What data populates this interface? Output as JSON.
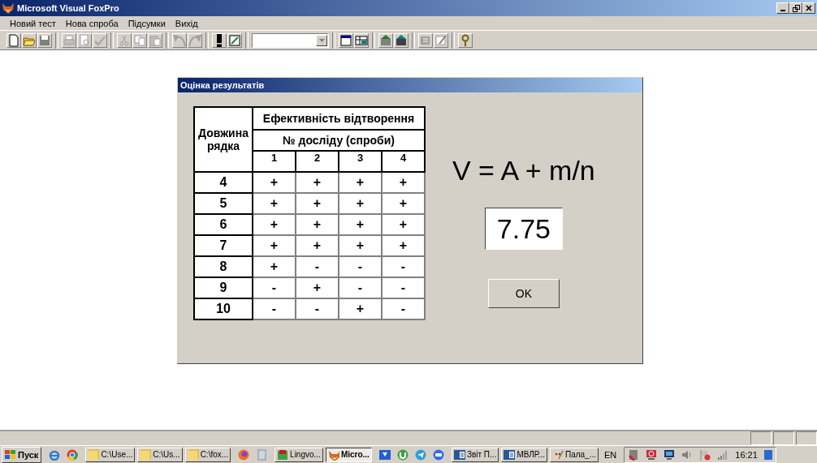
{
  "window": {
    "title": "Microsoft Visual FoxPro"
  },
  "menu": [
    "Новий тест",
    "Нова спроба",
    "Підсумки",
    "Вихід"
  ],
  "toolbar": {
    "combo_value_empty": true
  },
  "dialog": {
    "title": "Оцінка результатів",
    "table": {
      "row_header": "Довжина рядка",
      "group_header": "Ефективність відтворення",
      "subgroup_header": "№ досліду (спроби)",
      "columns": [
        "1",
        "2",
        "3",
        "4"
      ],
      "rows": [
        {
          "length": "4",
          "results": [
            "+",
            "+",
            "+",
            "+"
          ]
        },
        {
          "length": "5",
          "results": [
            "+",
            "+",
            "+",
            "+"
          ]
        },
        {
          "length": "6",
          "results": [
            "+",
            "+",
            "+",
            "+"
          ]
        },
        {
          "length": "7",
          "results": [
            "+",
            "+",
            "+",
            "+"
          ]
        },
        {
          "length": "8",
          "results": [
            "+",
            "-",
            "-",
            "-"
          ]
        },
        {
          "length": "9",
          "results": [
            "-",
            "+",
            "-",
            "-"
          ]
        },
        {
          "length": "10",
          "results": [
            "-",
            "-",
            "+",
            "-"
          ]
        }
      ]
    },
    "formula": "V = A + m/n",
    "result": "7.75",
    "ok_button": "OK"
  },
  "taskbar": {
    "start": "Пуск",
    "tasks": [
      {
        "label": "C:\\Use...",
        "selected": false
      },
      {
        "label": "C:\\Us...",
        "selected": false
      },
      {
        "label": "C:\\fox...",
        "selected": false
      },
      {
        "label": "Lingvo...",
        "selected": false
      },
      {
        "label": "Micro...",
        "selected": true
      },
      {
        "label": "Звіт П...",
        "selected": false
      },
      {
        "label": "МВЛР...",
        "selected": false
      },
      {
        "label": "Пала_...",
        "selected": false
      }
    ],
    "language": "EN",
    "clock": "16:21"
  }
}
